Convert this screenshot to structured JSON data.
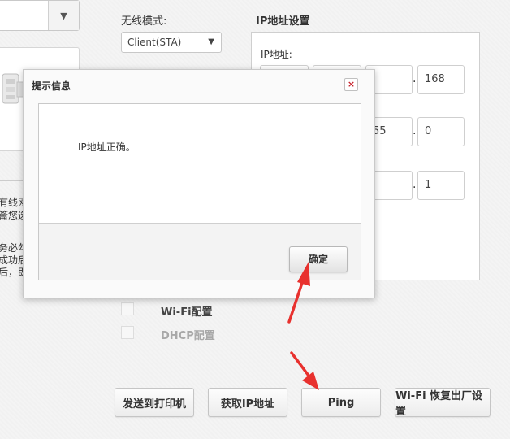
{
  "top_left_dropdown": {
    "caret": "▼"
  },
  "left_partial_text": [
    "有线网",
    "籥您选",
    "务必勾",
    "成功后",
    "后，即"
  ],
  "wireless": {
    "label": "无线模式:",
    "value": "Client(STA)",
    "caret": "▼"
  },
  "ip_settings": {
    "title": "IP地址设置",
    "ip_label": "IP地址:",
    "row1_last": "168",
    "row2_third": "55",
    "row2_last": "0",
    "row3_last": "1",
    "separator": "."
  },
  "options": [
    {
      "label": "Wi-Fi配置",
      "enabled": true
    },
    {
      "label": "DHCP配置",
      "enabled": false
    }
  ],
  "buttons": {
    "send": "发送到打印机",
    "get_ip": "获取IP地址",
    "ping": "Ping",
    "wifi_reset": "Wi-Fi 恢复出厂设置"
  },
  "dialog": {
    "title": "提示信息",
    "close": "×",
    "message": "IP地址正确。",
    "ok": "确定"
  },
  "colors": {
    "arrow": "#e8312e",
    "close_x": "#c8232c",
    "divider": "#e7b3b3"
  }
}
